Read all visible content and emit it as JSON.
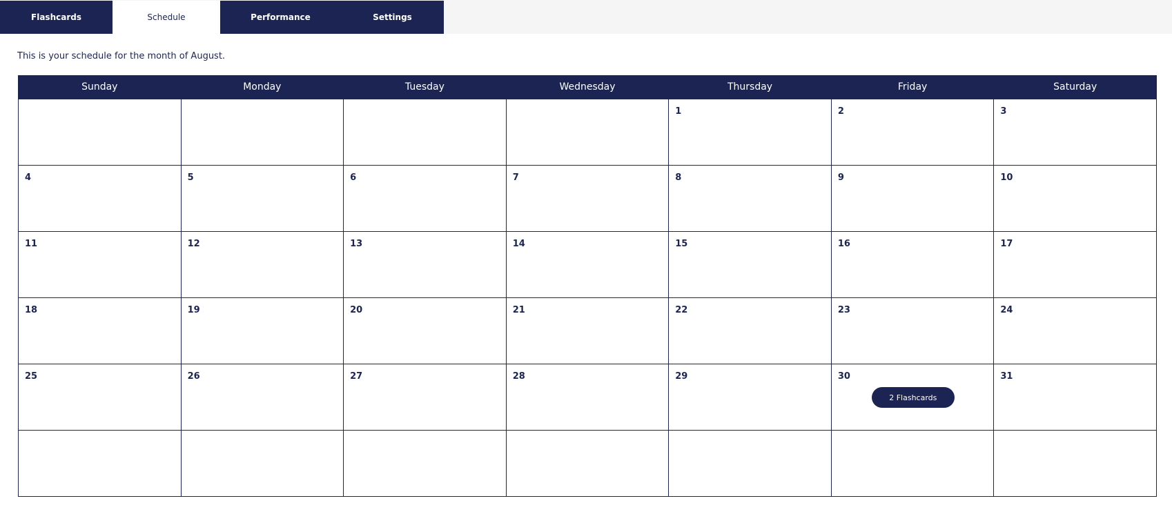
{
  "tabs": [
    {
      "label": "Flashcards",
      "active": false
    },
    {
      "label": "Schedule",
      "active": true
    },
    {
      "label": "Performance",
      "active": false
    },
    {
      "label": "Settings",
      "active": false
    }
  ],
  "intro_text": "This is your schedule for the month of August.",
  "calendar": {
    "weekdays": [
      "Sunday",
      "Monday",
      "Tuesday",
      "Wednesday",
      "Thursday",
      "Friday",
      "Saturday"
    ],
    "weeks": [
      [
        "",
        "",
        "",
        "",
        "1",
        "2",
        "3"
      ],
      [
        "4",
        "5",
        "6",
        "7",
        "8",
        "9",
        "10"
      ],
      [
        "11",
        "12",
        "13",
        "14",
        "15",
        "16",
        "17"
      ],
      [
        "18",
        "19",
        "20",
        "21",
        "22",
        "23",
        "24"
      ],
      [
        "25",
        "26",
        "27",
        "28",
        "29",
        "30",
        "31"
      ],
      [
        "",
        "",
        "",
        "",
        "",
        "",
        ""
      ]
    ],
    "events": [
      {
        "day": "30",
        "label": "2 Flashcards"
      }
    ]
  },
  "colors": {
    "primary": "#1b2452",
    "tabbar_background": "#f5f5f5",
    "page_background": "#ffffff"
  }
}
